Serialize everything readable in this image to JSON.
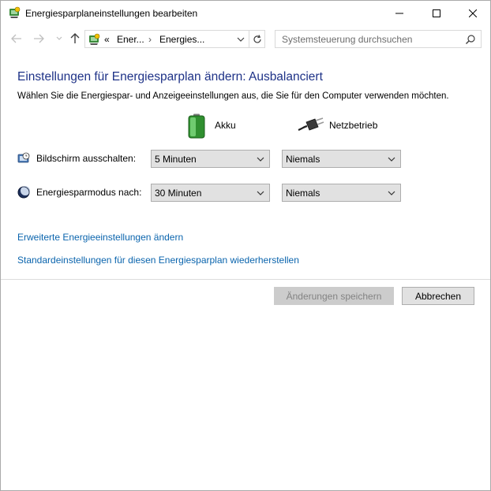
{
  "window": {
    "title": "Energiesparplaneinstellungen bearbeiten",
    "icon": "power-options-icon"
  },
  "address_bar": {
    "prefix": "«",
    "crumbs": [
      "Ener...",
      "Energies..."
    ],
    "separator": "›"
  },
  "search": {
    "placeholder": "Systemsteuerung durchsuchen"
  },
  "page": {
    "heading": "Einstellungen für Energiesparplan ändern: Ausbalanciert",
    "subtitle": "Wählen Sie die Energiespar- und Anzeigeeinstellungen aus, die Sie für den Computer verwenden möchten."
  },
  "columns": {
    "battery_label": "Akku",
    "plugged_label": "Netzbetrieb"
  },
  "settings": [
    {
      "label": "Bildschirm ausschalten:",
      "battery_value": "5 Minuten",
      "plugged_value": "Niemals"
    },
    {
      "label": "Energiesparmodus nach:",
      "battery_value": "30 Minuten",
      "plugged_value": "Niemals"
    }
  ],
  "links": {
    "advanced": "Erweiterte Energieeinstellungen ändern",
    "restore": "Standardeinstellungen für diesen Energiesparplan wiederherstellen"
  },
  "buttons": {
    "save": "Änderungen speichern",
    "cancel": "Abbrechen"
  },
  "colors": {
    "heading": "#1e3287",
    "link": "#0a64ad",
    "disabled_text": "#838383",
    "battery_green": "#3cb043"
  }
}
